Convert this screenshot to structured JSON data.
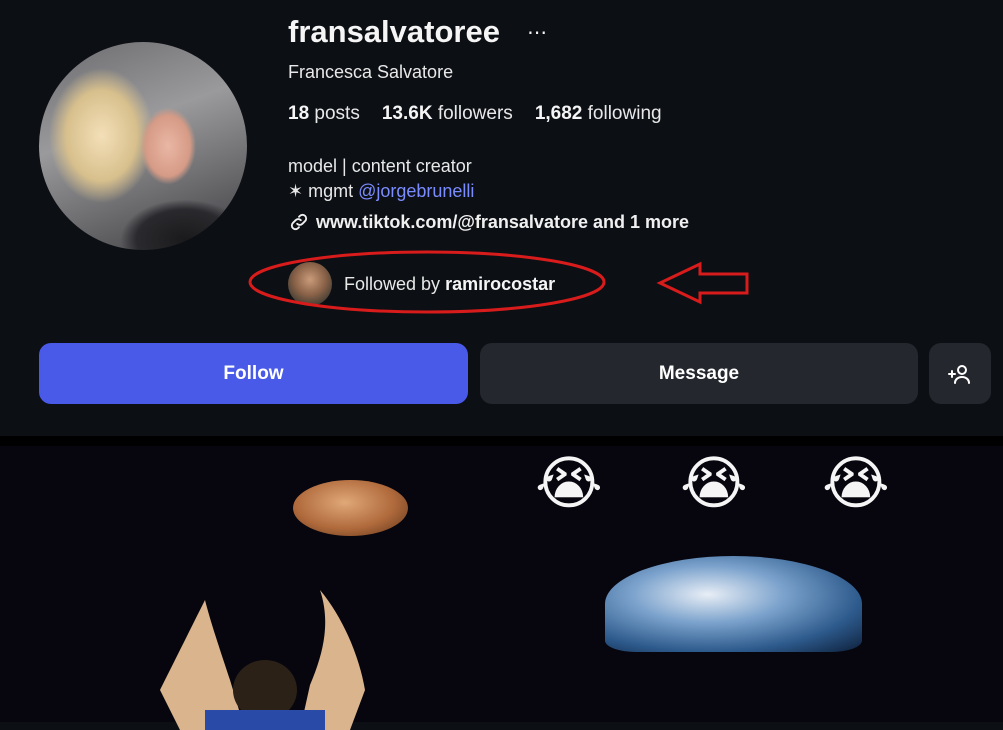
{
  "profile": {
    "username": "fransalvatoree",
    "more_icon": "⋯",
    "full_name": "Francesca Salvatore",
    "stats": {
      "posts_count": "18",
      "posts_label": "posts",
      "followers_count": "13.6K",
      "followers_label": "followers",
      "following_count": "1,682",
      "following_label": "following"
    },
    "bio_line1": "model | content creator",
    "bio_line2_prefix": "✶ mgmt ",
    "bio_line2_mention": "@jorgebrunelli",
    "link_text": "www.tiktok.com/@fransalvatore and 1 more",
    "followed_by_prefix": "Followed by ",
    "followed_by_user": "ramirocostar"
  },
  "actions": {
    "follow_label": "Follow",
    "message_label": "Message",
    "add_person_icon": "+👤"
  },
  "media": {
    "emojis": [
      "😭",
      "😭",
      "😭"
    ]
  },
  "colors": {
    "background": "#0c0f14",
    "follow_button": "#4a5ae8",
    "secondary_button": "#24272d",
    "mention": "#7b8cff",
    "annotation_red": "#d81b1b"
  }
}
